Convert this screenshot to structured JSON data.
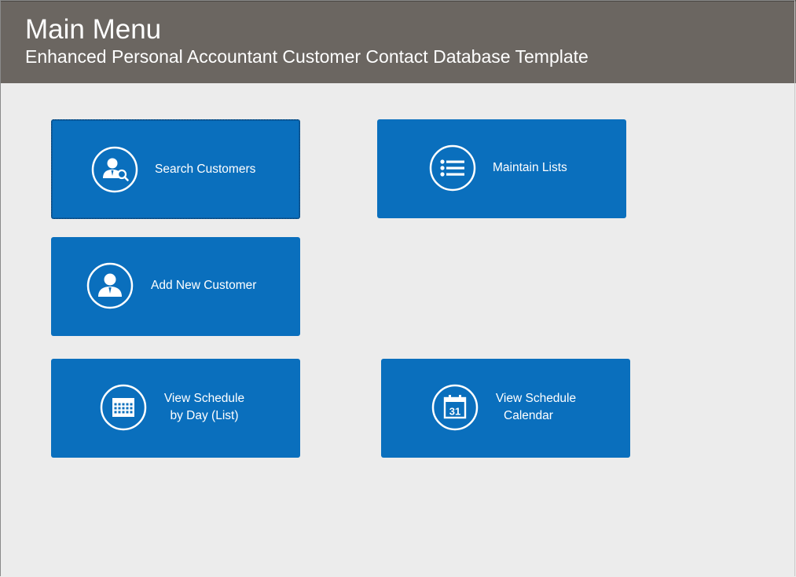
{
  "header": {
    "title": "Main Menu",
    "subtitle": "Enhanced Personal Accountant Customer Contact Database Template"
  },
  "colors": {
    "header_bg": "#6b6661",
    "page_bg": "#ececec",
    "tile_bg": "#0a6fbd",
    "text": "#ffffff"
  },
  "tiles": {
    "search_customers": {
      "label": "Search Customers",
      "icon": "user-search-icon"
    },
    "maintain_lists": {
      "label": "Maintain Lists",
      "icon": "list-icon"
    },
    "add_new_customer": {
      "label": "Add New Customer",
      "icon": "user-icon"
    },
    "view_schedule_list": {
      "line1": "View Schedule",
      "line2": "by Day (List)",
      "icon": "calendar-grid-icon"
    },
    "view_schedule_calendar": {
      "line1": "View Schedule",
      "line2": "Calendar",
      "icon": "calendar-day-icon",
      "day": "31"
    }
  }
}
